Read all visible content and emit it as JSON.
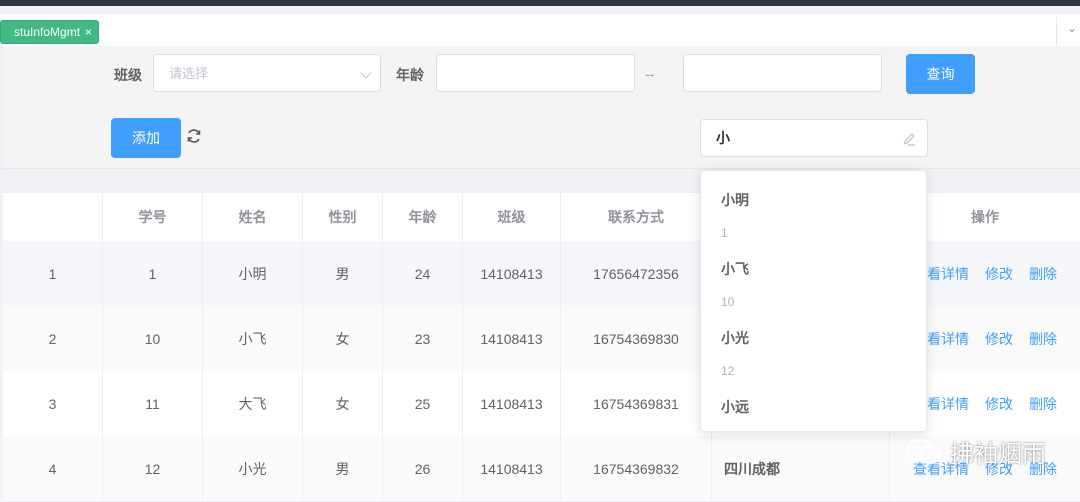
{
  "tags": {
    "active": "stuInfoMgmt",
    "close": "×",
    "right_icon": "⌄"
  },
  "search": {
    "class_label": "班级",
    "class_placeholder": "请选择",
    "age_label": "年龄",
    "age_from": "",
    "age_sep": "--",
    "age_to": "",
    "query_button": "查询"
  },
  "actions": {
    "add_button": "添加",
    "autocomplete_value": "小"
  },
  "suggestions": [
    {
      "name": "小明",
      "id": "1"
    },
    {
      "name": "小飞",
      "id": "10"
    },
    {
      "name": "小光",
      "id": "12"
    },
    {
      "name": "小远",
      "id": ""
    }
  ],
  "table": {
    "headers": [
      "",
      "学号",
      "姓名",
      "性别",
      "年龄",
      "班级",
      "联系方式",
      "",
      "操作"
    ],
    "rows": [
      [
        "1",
        "1",
        "小明",
        "男",
        "24",
        "14108413",
        "17656472356",
        ""
      ],
      [
        "2",
        "10",
        "小飞",
        "女",
        "23",
        "14108413",
        "16754369830",
        ""
      ],
      [
        "3",
        "11",
        "大飞",
        "女",
        "25",
        "14108413",
        "16754369831",
        ""
      ],
      [
        "4",
        "12",
        "小光",
        "男",
        "26",
        "14108413",
        "16754369832",
        "四川成都"
      ]
    ],
    "ops": {
      "detail": "查看详情",
      "edit": "修改",
      "delete": "删除"
    }
  },
  "watermark": "拂袖烟雨"
}
